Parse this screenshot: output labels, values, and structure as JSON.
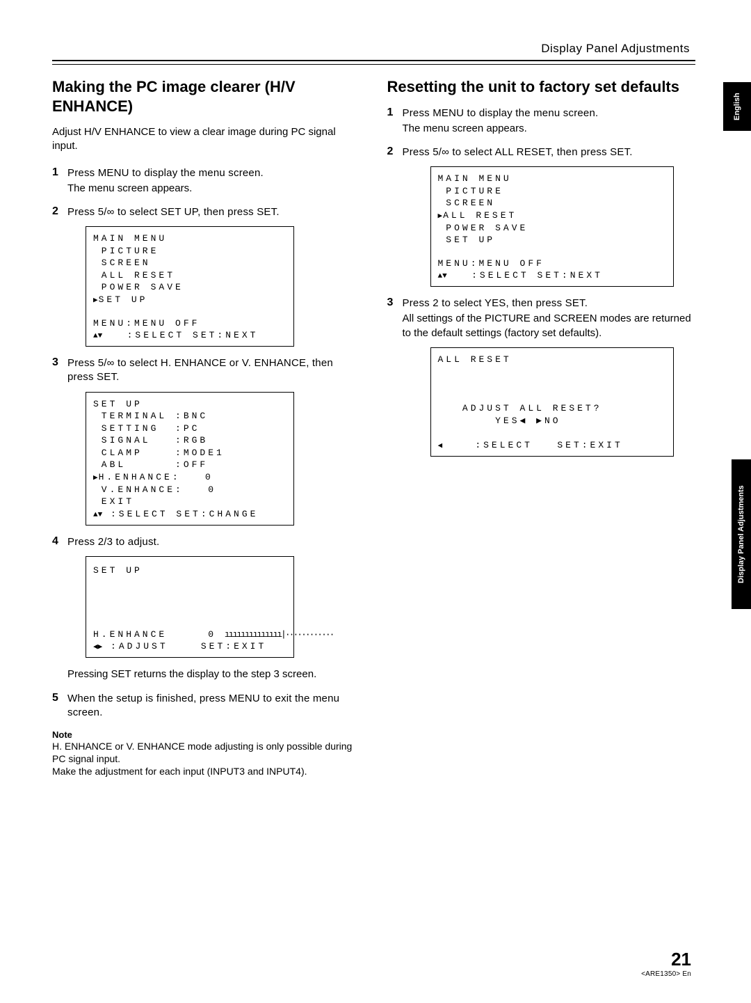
{
  "header": "Display Panel Adjustments",
  "tabs": {
    "english": "English",
    "dpa": "Display Panel Adjustments"
  },
  "left": {
    "title": "Making the PC image clearer (H/V ENHANCE)",
    "intro": "Adjust H/V ENHANCE to view a clear image during PC signal input.",
    "step1_main": "Press MENU to display the menu screen.",
    "step1_sub": "The menu screen appears.",
    "step2_main": "Press 5/∞ to select SET UP, then press SET.",
    "osd1_title": "MAIN MENU",
    "osd1_l1": " PICTURE",
    "osd1_l2": " SCREEN",
    "osd1_l3": " ALL RESET",
    "osd1_l4": " POWER SAVE",
    "osd1_sel": "SET UP",
    "osd1_foot1": "MENU:MENU OFF",
    "osd1_foot2": "   :SELECT SET:NEXT",
    "step3_main": "Press 5/∞ to select H. ENHANCE or V. ENHANCE, then press SET.",
    "osd2_title": "SET UP",
    "osd2_l1": " TERMINAL :BNC",
    "osd2_l2": " SETTING  :PC",
    "osd2_l3": " SIGNAL   :RGB",
    "osd2_l4": " CLAMP    :MODE1",
    "osd2_l5": " ABL      :OFF",
    "osd2_sel": "H.ENHANCE:   0",
    "osd2_l7": " V.ENHANCE:   0",
    "osd2_l8": " EXIT",
    "osd2_foot": " :SELECT SET:CHANGE",
    "step4_main": "Press 2/3 to adjust.",
    "osd3_title": "SET UP",
    "osd3_line": "H.ENHANCE     0",
    "osd3_foot": " :ADJUST    SET:EXIT",
    "after4": "Pressing SET returns the display to the step 3 screen.",
    "step5_main": "When the setup is finished, press MENU to exit the menu screen.",
    "note_h": "Note",
    "note_body1": "H. ENHANCE or V. ENHANCE mode adjusting is only possible during PC signal input.",
    "note_body2": "Make the adjustment for each input (INPUT3 and INPUT4)."
  },
  "right": {
    "title": "Resetting the unit to factory set defaults",
    "step1_main": "Press MENU to display the menu screen.",
    "step1_sub": "The menu screen appears.",
    "step2_main": "Press 5/∞ to select ALL RESET, then press SET.",
    "osd1_title": "MAIN MENU",
    "osd1_l1": " PICTURE",
    "osd1_l2": " SCREEN",
    "osd1_sel": "ALL RESET",
    "osd1_l4": " POWER SAVE",
    "osd1_l5": " SET UP",
    "osd1_foot1": "MENU:MENU OFF",
    "osd1_foot2": "   :SELECT SET:NEXT",
    "step3_main": "Press 2 to select YES, then press SET.",
    "step3_sub": "All settings of the PICTURE and SCREEN modes are returned to the default settings (factory set defaults).",
    "osd2_title": "ALL RESET",
    "osd2_q": "   ADJUST ALL RESET?",
    "osd2_yn": "       YES◀ ▶NO",
    "osd2_foot": "    :SELECT   SET:EXIT"
  },
  "footer": {
    "page": "21",
    "code": "<ARE1350> En"
  }
}
